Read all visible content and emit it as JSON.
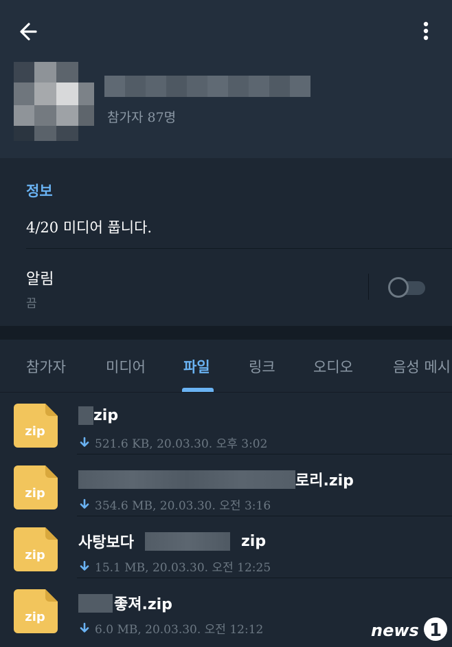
{
  "header": {
    "member_count": "참가자 87명"
  },
  "info": {
    "heading": "정보",
    "description": "4/20 미디어 풉니다.",
    "notification_label": "알림",
    "notification_value": "끔",
    "notification_enabled": false
  },
  "tabs": [
    {
      "label": "참가자",
      "active": false
    },
    {
      "label": "미디어",
      "active": false
    },
    {
      "label": "파일",
      "active": true
    },
    {
      "label": "링크",
      "active": false
    },
    {
      "label": "오디오",
      "active": false
    },
    {
      "label": "음성 메시",
      "active": false
    }
  ],
  "files": [
    {
      "icon_label": "zip",
      "name_suffix": "zip",
      "meta": "521.6 KB, 20.03.30. 오후 3:02"
    },
    {
      "icon_label": "zip",
      "name_suffix": "로리.zip",
      "meta": "354.6 MB, 20.03.30. 오전 3:16"
    },
    {
      "icon_label": "zip",
      "name_prefix": "사탕보다",
      "name_suffix": "zip",
      "meta": "15.1 MB, 20.03.30. 오전 12:25"
    },
    {
      "icon_label": "zip",
      "name_suffix": "좋져.zip",
      "meta": "6.0 MB, 20.03.30. 오전 12:12"
    }
  ],
  "watermark": {
    "text": "news",
    "number": "1"
  },
  "colors": {
    "accent": "#6ab3f3",
    "header_bg": "#232f3d",
    "body_bg": "#1d2733",
    "secondary_text": "#6c7883",
    "file_icon": "#f2c55c"
  }
}
